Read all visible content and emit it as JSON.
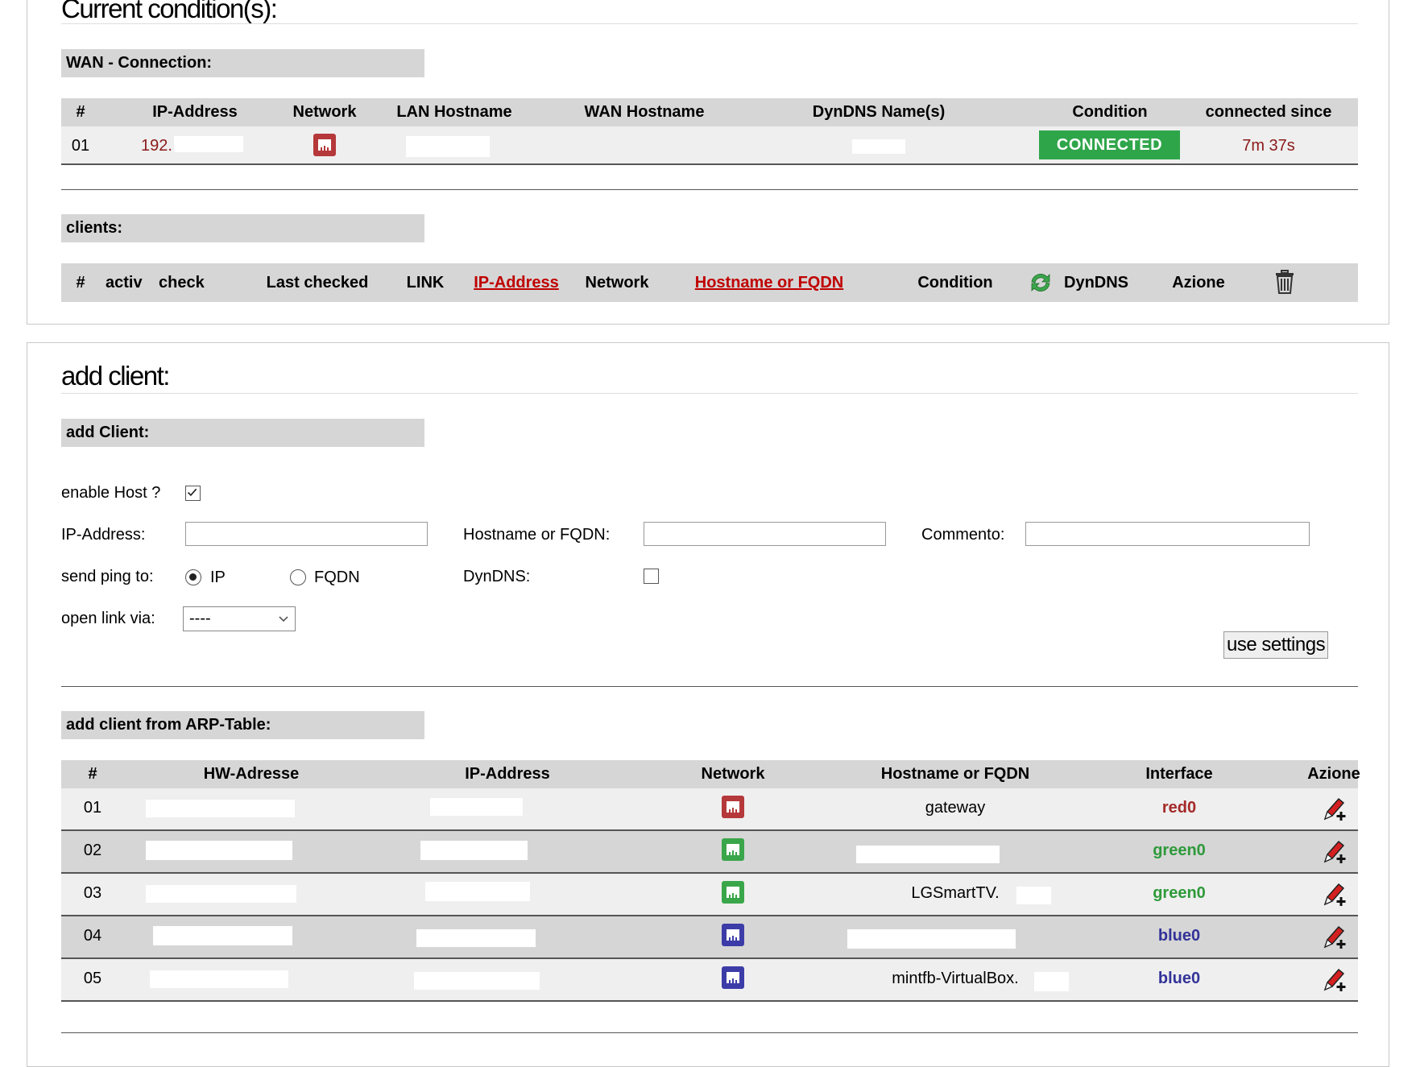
{
  "conditions": {
    "title": "Current condition(s):",
    "wan_header": "WAN - Connection:",
    "wan_columns": [
      "#",
      "IP-Address",
      "Network",
      "LAN Hostname",
      "WAN Hostname",
      "DynDNS Name(s)",
      "Condition",
      "connected since"
    ],
    "wan_row": {
      "num": "01",
      "ip": "192.",
      "network": "red-network-icon",
      "condition": "CONNECTED",
      "since": "7m 37s"
    },
    "clients_header": "clients:",
    "client_columns": {
      "num": "#",
      "activ": "activ",
      "check": "check",
      "last": "Last checked",
      "link": "LINK",
      "ip": "IP-Address",
      "network": "Network",
      "host": "Hostname or FQDN",
      "condition": "Condition",
      "dyndns": "DynDNS",
      "azione": "Azione"
    }
  },
  "add_client": {
    "title": "add client:",
    "section_header": "add Client:",
    "enable_host_label": "enable Host ?",
    "enable_host_checked": true,
    "ip_label": "IP-Address:",
    "ip_value": "",
    "hostname_label": "Hostname or FQDN:",
    "hostname_value": "",
    "comment_label": "Commento:",
    "comment_value": "",
    "ping_label": "send ping to:",
    "ping_options": [
      "IP",
      "FQDN"
    ],
    "ping_selected": "IP",
    "dyndns_label": "DynDNS:",
    "dyndns_checked": false,
    "open_link_label": "open link via:",
    "open_link_value": "----",
    "submit_label": "use settings"
  },
  "arp": {
    "header": "add client from ARP-Table:",
    "columns": [
      "#",
      "HW-Adresse",
      "IP-Address",
      "Network",
      "Hostname or FQDN",
      "Interface",
      "Azione"
    ],
    "rows": [
      {
        "num": "01",
        "host": "gateway",
        "iface": "red0",
        "color": "#a52a2a",
        "net": "red"
      },
      {
        "num": "02",
        "host": "",
        "iface": "green0",
        "color": "#2e9a3a",
        "net": "green"
      },
      {
        "num": "03",
        "host": "LGSmartTV.",
        "iface": "green0",
        "color": "#2e9a3a",
        "net": "green"
      },
      {
        "num": "04",
        "host": "",
        "iface": "blue0",
        "color": "#333399",
        "net": "blue"
      },
      {
        "num": "05",
        "host": "mintfb-VirtualBox.",
        "iface": "blue0",
        "color": "#333399",
        "net": "blue"
      }
    ]
  },
  "colors": {
    "red": "#b5383a",
    "green": "#3aa64a",
    "blue": "#3c3ca8",
    "connected": "#2fa54a"
  }
}
